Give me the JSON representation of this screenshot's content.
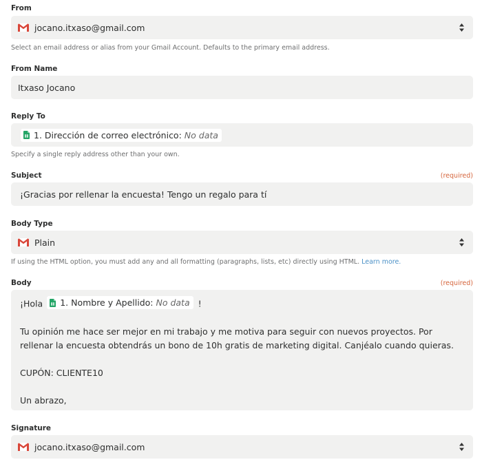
{
  "from": {
    "label": "From",
    "value": "jocano.itxaso@gmail.com",
    "hint": "Select an email address or alias from your Gmail Account. Defaults to the primary email address."
  },
  "from_name": {
    "label": "From Name",
    "value": "Itxaso Jocano"
  },
  "reply_to": {
    "label": "Reply To",
    "token_label": "1. Dirección de correo electrónico:",
    "token_value": "No data",
    "hint": "Specify a single reply address other than your own."
  },
  "subject": {
    "label": "Subject",
    "required": "(required)",
    "value": "¡Gracias por rellenar la encuesta! Tengo un regalo para tí"
  },
  "body_type": {
    "label": "Body Type",
    "value": "Plain",
    "hint": "If using the HTML option, you must add any and all formatting (paragraphs, lists, etc) directly using HTML.",
    "learn_more": "Learn more."
  },
  "body": {
    "label": "Body",
    "required": "(required)",
    "greeting_prefix": "¡Hola",
    "token_label": "1. Nombre y Apellido:",
    "token_value": "No data",
    "greeting_suffix": "!",
    "paragraph": "Tu opinión me hace ser mejor en mi trabajo y me motiva para seguir con nuevos proyectos. Por rellenar la encuesta obtendrás un bono de 10h gratis de marketing digital. Canjéalo cuando quieras.",
    "coupon": "CUPÓN: CLIENTE10",
    "closing": "Un abrazo,"
  },
  "signature": {
    "label": "Signature",
    "value": "jocano.itxaso@gmail.com"
  },
  "colors": {
    "field_bg": "#f1f1f0",
    "required": "#d5643b",
    "link": "#4a90c6"
  },
  "icons": {
    "gmail": "gmail-icon",
    "sheets": "google-sheets-icon",
    "sorter": "sort-arrows-icon"
  }
}
